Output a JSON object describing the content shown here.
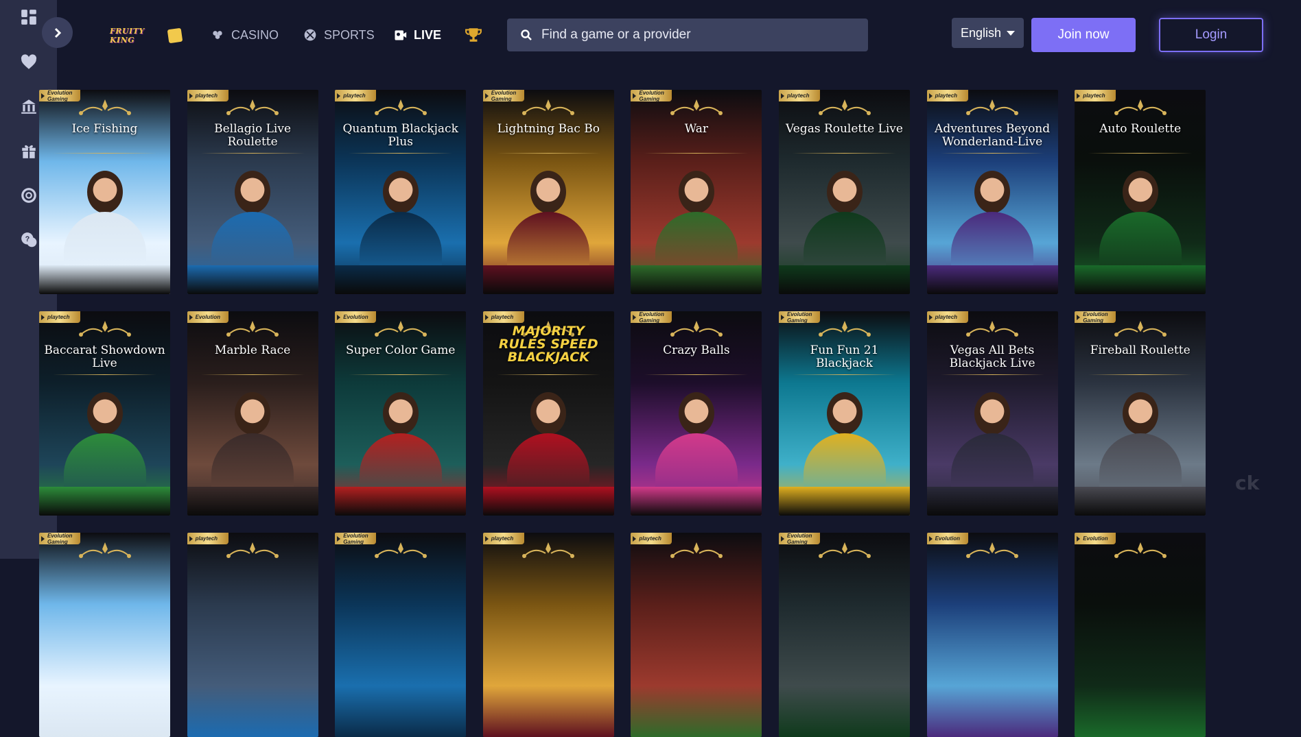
{
  "brand": {
    "logo_text": "FRUITY KING"
  },
  "sidebar": {
    "items": [
      {
        "icon": "dashboard-icon"
      },
      {
        "icon": "heart-icon"
      },
      {
        "icon": "vault-icon"
      },
      {
        "icon": "gift-icon"
      },
      {
        "icon": "target-icon"
      },
      {
        "icon": "support-icon"
      }
    ]
  },
  "nav": {
    "casino": "CASINO",
    "sports": "SPORTS",
    "live": "LIVE"
  },
  "search": {
    "placeholder": "Find a game or a provider"
  },
  "language": {
    "selected": "English"
  },
  "auth": {
    "join_label": "Join now",
    "login_label": "Login"
  },
  "colors": {
    "accent": "#7d6ff5",
    "background": "#14172b",
    "sidebar": "#2a2e47",
    "gold": "#d8b45a"
  },
  "games": [
    {
      "title": "Ice Fishing",
      "provider": "Evolution Gaming"
    },
    {
      "title": "Bellagio Live Roulette",
      "provider": "playtech"
    },
    {
      "title": "Quantum Blackjack Plus",
      "provider": "playtech"
    },
    {
      "title": "Lightning Bac Bo",
      "provider": "Evolution Gaming"
    },
    {
      "title": "War",
      "provider": "Evolution Gaming"
    },
    {
      "title": "Vegas Roulette Live",
      "provider": "playtech"
    },
    {
      "title": "Adventures Beyond Wonderland-Live",
      "provider": "playtech"
    },
    {
      "title": "Auto Roulette",
      "provider": "playtech"
    },
    {
      "title": "Baccarat Showdown Live",
      "provider": "playtech"
    },
    {
      "title": "Marble Race",
      "provider": "Evolution"
    },
    {
      "title": "Super Color Game",
      "provider": "Evolution"
    },
    {
      "title": "MAJORITY RULES SPEED BLACKJACK",
      "provider": "playtech"
    },
    {
      "title": "Crazy Balls",
      "provider": "Evolution Gaming"
    },
    {
      "title": "Fun Fun 21 Blackjack",
      "provider": "Evolution Gaming"
    },
    {
      "title": "Vegas All Bets Blackjack Live",
      "provider": "playtech"
    },
    {
      "title": "Fireball Roulette",
      "provider": "Evolution Gaming"
    },
    {
      "title": "",
      "provider": "Evolution Gaming"
    },
    {
      "title": "",
      "provider": "playtech"
    },
    {
      "title": "",
      "provider": "Evolution Gaming"
    },
    {
      "title": "",
      "provider": "playtech"
    },
    {
      "title": "",
      "provider": "playtech"
    },
    {
      "title": "",
      "provider": "Evolution Gaming"
    },
    {
      "title": "",
      "provider": "Evolution"
    },
    {
      "title": "",
      "provider": "Evolution"
    }
  ]
}
